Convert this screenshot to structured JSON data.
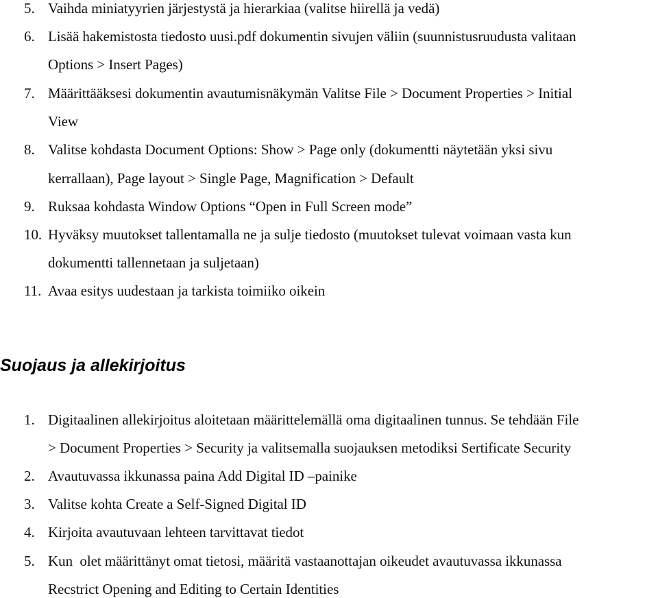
{
  "list1": {
    "items": [
      {
        "num": "5.",
        "lines": [
          "Vaihda miniatyyrien järjestystä ja hierarkiaa (valitse hiirellä ja vedä)"
        ]
      },
      {
        "num": "6.",
        "lines": [
          "Lisää hakemistosta tiedosto uusi.pdf dokumentin sivujen väliin (suunnistusruudusta valitaan",
          "Options > Insert Pages)"
        ]
      },
      {
        "num": "7.",
        "lines": [
          "Määrittääksesi dokumentin avautumisnäkymän Valitse File > Document Properties > Initial",
          "View"
        ]
      },
      {
        "num": "8.",
        "lines": [
          "Valitse kohdasta Document Options: Show > Page only (dokumentti näytetään yksi sivu",
          "kerrallaan), Page layout > Single Page, Magnification > Default"
        ]
      },
      {
        "num": "9.",
        "lines": [
          "Ruksaa kohdasta Window Options “Open in Full Screen mode”"
        ]
      },
      {
        "num": "10.",
        "lines": [
          "Hyväksy muutokset tallentamalla ne ja sulje tiedosto (muutokset tulevat voimaan vasta kun",
          "dokumentti tallennetaan ja suljetaan)"
        ]
      },
      {
        "num": "11.",
        "lines": [
          "Avaa esitys uudestaan ja tarkista toimiiko oikein"
        ]
      }
    ]
  },
  "section2": {
    "heading": "Suojaus ja allekirjoitus",
    "items": [
      {
        "num": "1.",
        "lines": [
          "Digitaalinen allekirjoitus aloitetaan määrittelemällä oma digitaalinen tunnus. Se tehdään File",
          "> Document Properties > Security ja valitsemalla suojauksen metodiksi Sertificate Security"
        ]
      },
      {
        "num": "2.",
        "lines": [
          "Avautuvassa ikkunassa paina Add Digital ID –painike"
        ]
      },
      {
        "num": "3.",
        "lines": [
          "Valitse kohta Create a Self-Signed Digital ID"
        ]
      },
      {
        "num": "4.",
        "lines": [
          "Kirjoita avautuvaan lehteen tarvittavat tiedot"
        ]
      },
      {
        "num": "5.",
        "lines": [
          "Kun  olet määrittänyt omat tietosi, määritä vastaanottajan oikeudet avautuvassa ikkunassa",
          "Recstrict Opening and Editing to Certain Identities"
        ]
      }
    ]
  }
}
